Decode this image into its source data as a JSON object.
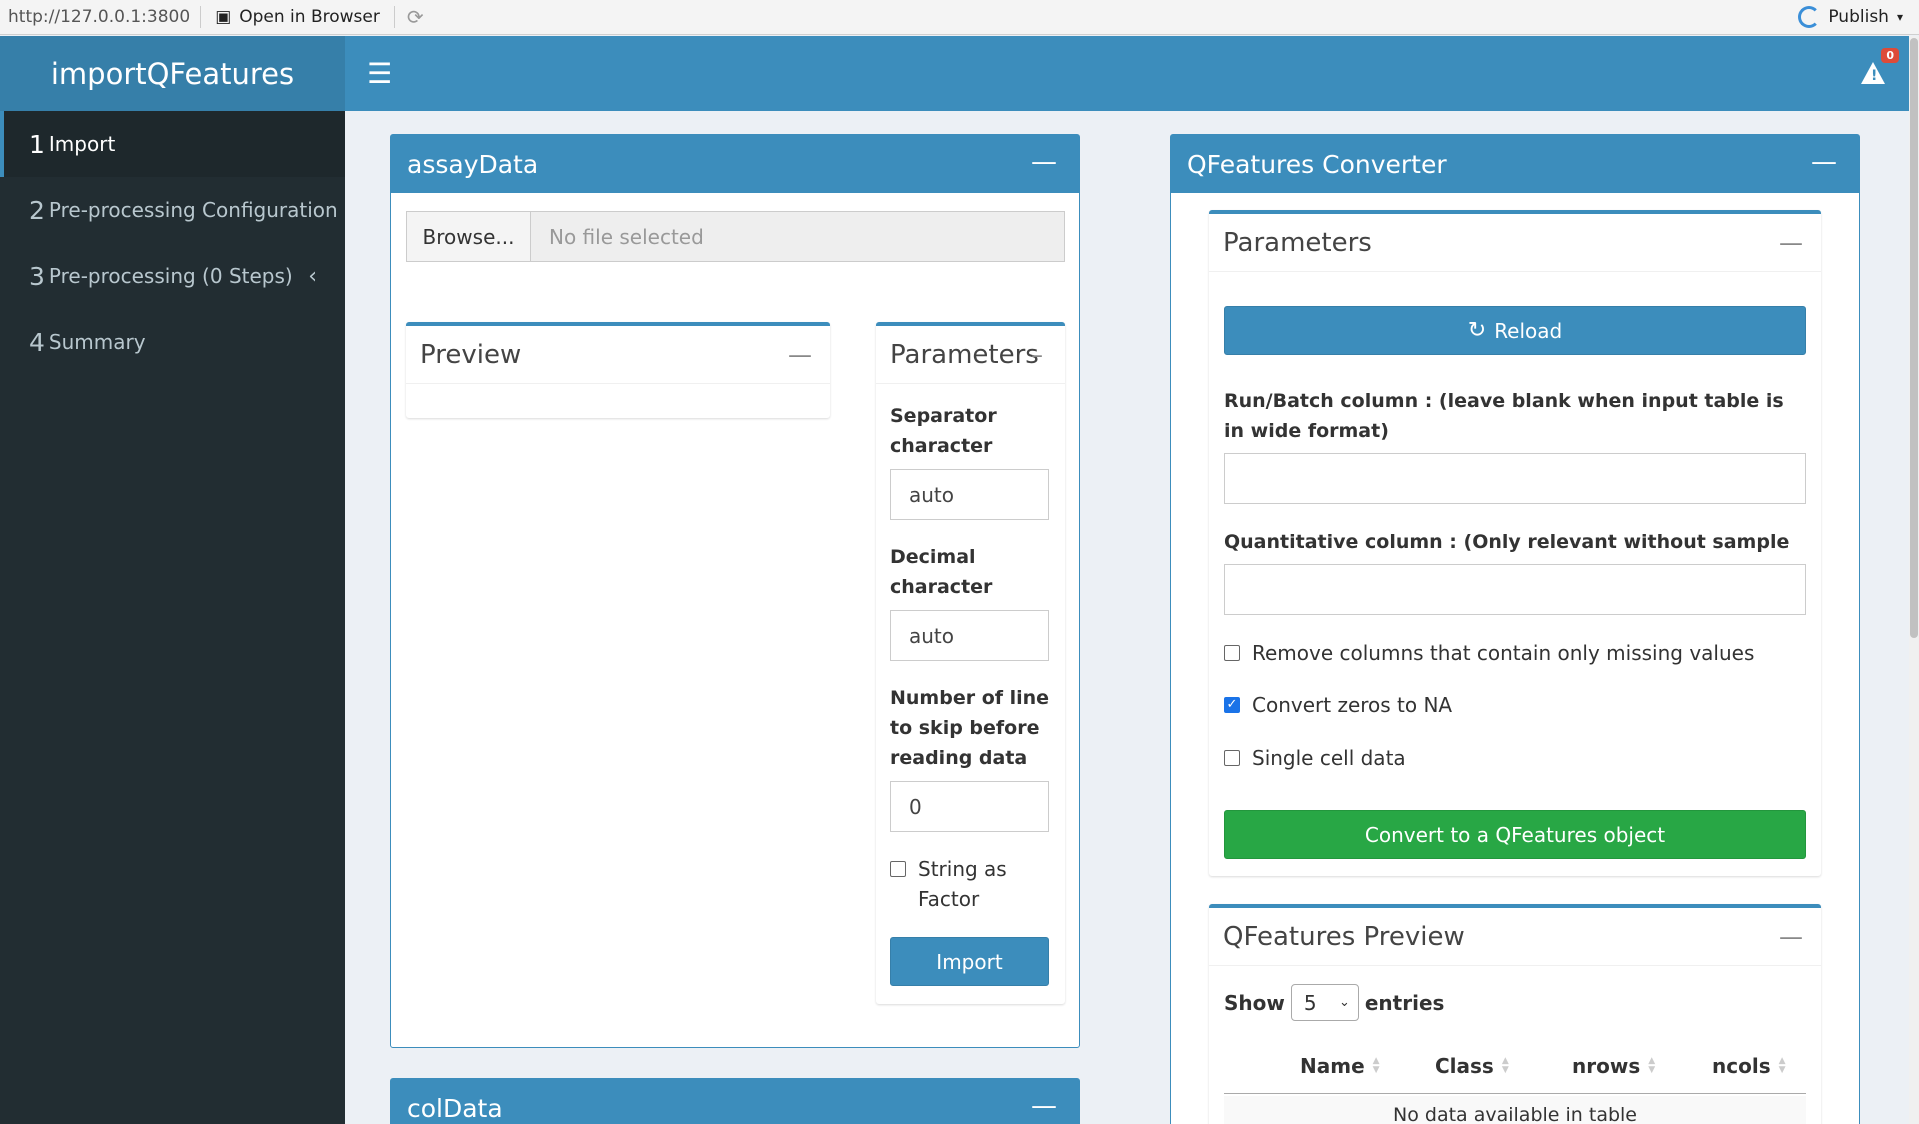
{
  "browser": {
    "url": "http://127.0.0.1:3800",
    "open_label": "Open in Browser",
    "publish_label": "Publish"
  },
  "app": {
    "title": "importQFeatures",
    "notifications_count": "0"
  },
  "sidebar": {
    "items": [
      {
        "num": "1",
        "label": "Import"
      },
      {
        "num": "2",
        "label": "Pre-processing Configuration"
      },
      {
        "num": "3",
        "label": "Pre-processing (0 Steps)"
      },
      {
        "num": "4",
        "label": "Summary"
      }
    ]
  },
  "assay": {
    "title": "assayData",
    "browse_label": "Browse...",
    "file_placeholder": "No file selected",
    "preview_title": "Preview",
    "params_title": "Parameters",
    "sep_label": "Separator character",
    "sep_value": "auto",
    "dec_label": "Decimal character",
    "dec_value": "auto",
    "skip_label": "Number of line to skip before reading data",
    "skip_value": "0",
    "string_factor_label": "String as Factor",
    "import_label": "Import"
  },
  "coldata": {
    "title": "colData"
  },
  "converter": {
    "title": "QFeatures Converter",
    "params_title": "Parameters",
    "reload_label": "Reload",
    "run_batch_label": "Run/Batch column : (leave blank when input table is in wide format)",
    "quant_label": "Quantitative column : (Only relevant without sample table)",
    "remove_missing_label": "Remove columns that contain only missing values",
    "zeros_na_label": "Convert zeros to NA",
    "single_cell_label": "Single cell data",
    "convert_label": "Convert to a QFeatures object",
    "preview_title": "QFeatures Preview",
    "show_label": "Show",
    "entries_value": "5",
    "entries_label": "entries",
    "columns": [
      "Name",
      "Class",
      "nrows",
      "ncols"
    ],
    "empty_message": "No data available in table"
  },
  "colors": {
    "primary": "#3c8dbc",
    "sidebar": "#222d32",
    "success": "#28a745",
    "danger": "#dd4b39"
  }
}
